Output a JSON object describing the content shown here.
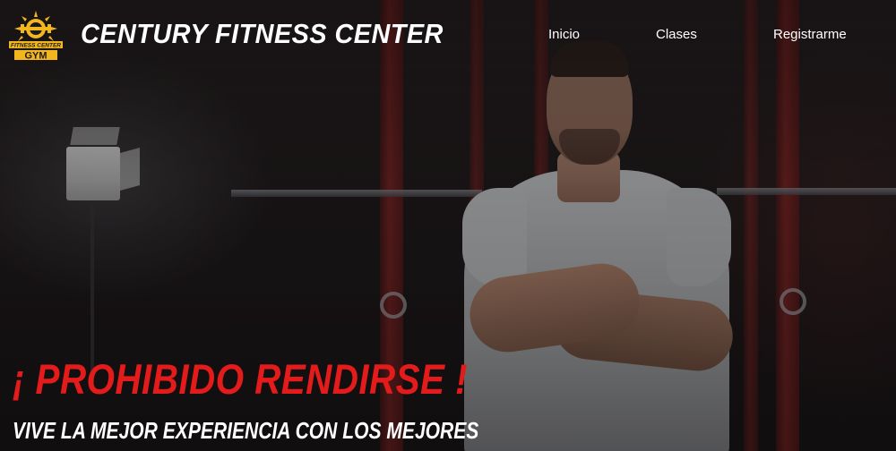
{
  "brand": {
    "logo_icon": "gym-emblem-icon",
    "logo_text_top": "FITNESS CENTER",
    "logo_text_bottom": "GYM",
    "name": "CENTURY FITNESS CENTER",
    "accent_color": "#f2b61f"
  },
  "nav": {
    "items": [
      {
        "label": "Inicio"
      },
      {
        "label": "Clases"
      },
      {
        "label": "Registrarme"
      }
    ]
  },
  "hero": {
    "image_icon": "athlete-arms-crossed-photo",
    "headline": "¡ PROHIBIDO RENDIRSE !",
    "headline_color": "#e41b1b",
    "subheadline": "VIVE LA MEJOR EXPERIENCIA CON LOS MEJORES"
  }
}
